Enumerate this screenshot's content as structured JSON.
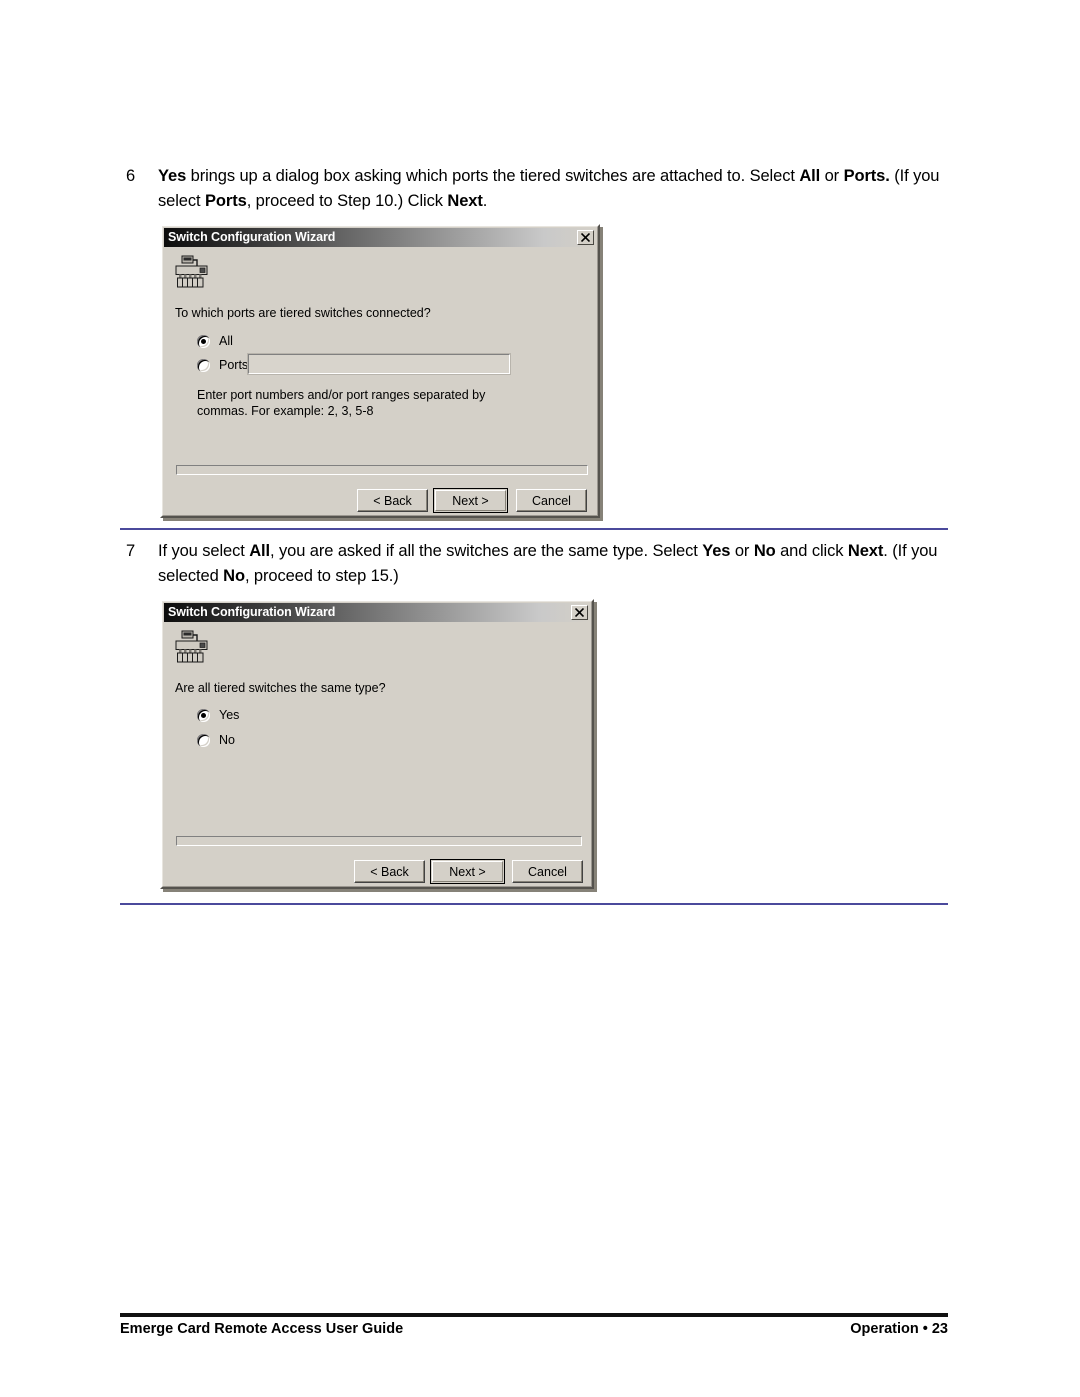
{
  "page": {
    "number": "23",
    "footer_left": "Emerge Card Remote Access User Guide",
    "footer_right": "Operation • 23",
    "rule_color": "#4b4a9c"
  },
  "steps": [
    {
      "number": "6",
      "text_parts": [
        {
          "t": "Yes",
          "b": true
        },
        {
          "t": " brings up a dialog box asking which ports the tiered switches are attached to. Select  ",
          "b": false
        },
        {
          "t": "All",
          "b": true
        },
        {
          "t": " or ",
          "b": false
        },
        {
          "t": "Ports.",
          "b": true
        },
        {
          "t": " (If you select ",
          "b": false
        },
        {
          "t": "Ports",
          "b": true
        },
        {
          "t": ", proceed to Step 10.) Click ",
          "b": false
        },
        {
          "t": "Next",
          "b": true
        },
        {
          "t": ".",
          "b": false
        }
      ]
    },
    {
      "number": "7",
      "text_parts": [
        {
          "t": "If you select ",
          "b": false
        },
        {
          "t": "All",
          "b": true
        },
        {
          "t": ", you are asked if all the switches are the same type. Select ",
          "b": false
        },
        {
          "t": "Yes",
          "b": true
        },
        {
          "t": " or ",
          "b": false
        },
        {
          "t": "No",
          "b": true
        },
        {
          "t": " and click ",
          "b": false
        },
        {
          "t": "Next",
          "b": true
        },
        {
          "t": ". (If you selected ",
          "b": false
        },
        {
          "t": "No",
          "b": true
        },
        {
          "t": ", proceed to step 15.)",
          "b": false
        }
      ]
    }
  ],
  "dialog1": {
    "title": "Switch Configuration Wizard",
    "close_label": "×",
    "icon_name": "network-switch-icon",
    "prompt": "To which ports are tiered switches connected?",
    "options": [
      {
        "label": "All",
        "checked": true
      },
      {
        "label": "Ports:",
        "checked": false
      }
    ],
    "ports_input_value": "",
    "ports_input_placeholder": "",
    "hint": "Enter port numbers and/or port ranges separated by\ncommas.  For example: 2, 3, 5-8",
    "buttons": {
      "back": "< Back",
      "next": "Next >",
      "cancel": "Cancel",
      "default_button": "next"
    }
  },
  "dialog2": {
    "title": "Switch Configuration Wizard",
    "close_label": "×",
    "icon_name": "network-switch-icon",
    "prompt": "Are all tiered switches the same type?",
    "options": [
      {
        "label": "Yes",
        "checked": true
      },
      {
        "label": "No",
        "checked": false
      }
    ],
    "buttons": {
      "back": "< Back",
      "next": "Next >",
      "cancel": "Cancel",
      "default_button": "next"
    }
  }
}
